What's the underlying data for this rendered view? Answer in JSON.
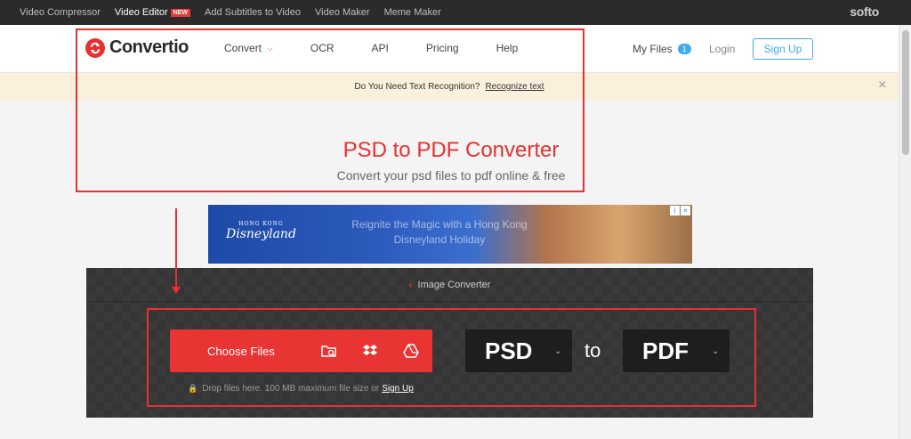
{
  "topbar": {
    "links": [
      {
        "label": "Video Compressor"
      },
      {
        "label": "Video Editor",
        "badge": "NEW"
      },
      {
        "label": "Add Subtitles to Video"
      },
      {
        "label": "Video Maker"
      },
      {
        "label": "Meme Maker"
      }
    ],
    "brand": "softo"
  },
  "header": {
    "logo": "Convertio",
    "nav": [
      "Convert",
      "OCR",
      "API",
      "Pricing",
      "Help"
    ],
    "my_files": "My Files",
    "my_files_count": "1",
    "login": "Login",
    "signup": "Sign Up"
  },
  "notice": {
    "text": "Do You Need Text Recognition?",
    "link": "Recognize text",
    "close": "×"
  },
  "hero": {
    "title": "PSD to PDF Converter",
    "subtitle": "Convert your psd files to pdf online & free"
  },
  "ad": {
    "brand_small": "HONG KONG",
    "brand": "Disneyland",
    "tagline": "Reignite the Magic with a Hong Kong Disneyland Holiday"
  },
  "converter": {
    "breadcrumb": "Image Converter",
    "choose_files": "Choose Files",
    "from_format": "PSD",
    "to_word": "to",
    "to_format": "PDF",
    "drop_text": "Drop files here. 100 MB maximum file size or",
    "drop_link": "Sign Up"
  },
  "colors": {
    "accent": "#e8302f",
    "signup_blue": "#3fa9f5",
    "notice_bg": "#faf0dc",
    "converter_bg": "#353535"
  }
}
